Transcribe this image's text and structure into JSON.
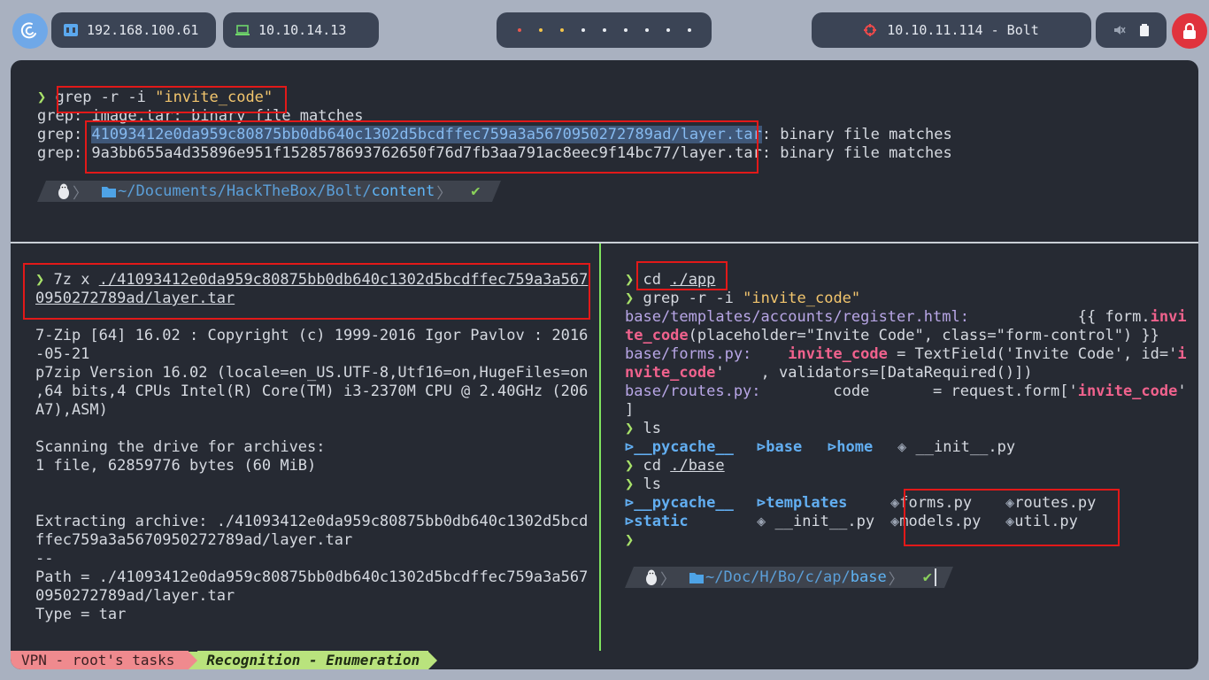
{
  "topbar": {
    "host_ip": "192.168.100.61",
    "vpn_ip": "10.10.14.13",
    "target": "10.10.11.114 - Bolt"
  },
  "top_pane": {
    "cmd1_prompt": "❯",
    "cmd1": "grep -r -i ",
    "cmd1_arg": "\"invite_code\"",
    "out1": "grep: image.tar: binary file matches",
    "out2_pre": "grep: ",
    "out2_path": "41093412e0da959c80875bb0db640c1302d5bcdffec759a3a5670950272789ad/layer.tar",
    "out2_post": ": binary file matches",
    "out3_pre": "grep: ",
    "out3_path": "9a3bb655a4d35896e951f1528578693762650f76d7fb3aa791ac8eec9f14bc77/layer.tar",
    "out3_post": ": binary file matches",
    "pl_dir": "~/Documents/HackTheBox/Bolt/",
    "pl_dir_last": "content",
    "pl_ok": "✔"
  },
  "left_pane": {
    "cmd_prompt": "❯",
    "cmd": "7z x ",
    "cmd_arg1": "./41093412e0da959c80875bb0db640c1302d5bcdffec759a3a567",
    "cmd_arg2": "0950272789ad/layer.tar",
    "lines": [
      "7-Zip [64] 16.02 : Copyright (c) 1999-2016 Igor Pavlov : 2016",
      "-05-21",
      "p7zip Version 16.02 (locale=en_US.UTF-8,Utf16=on,HugeFiles=on",
      ",64 bits,4 CPUs Intel(R) Core(TM) i3-2370M CPU @ 2.40GHz (206",
      "A7),ASM)",
      "",
      "Scanning the drive for archives:",
      "1 file, 62859776 bytes (60 MiB)",
      "",
      "",
      "Extracting archive: ./41093412e0da959c80875bb0db640c1302d5bcd",
      "ffec759a3a5670950272789ad/layer.tar",
      "--",
      "Path = ./41093412e0da959c80875bb0db640c1302d5bcdffec759a3a567",
      "0950272789ad/layer.tar",
      "Type = tar"
    ]
  },
  "right_pane": {
    "prompt": "❯",
    "cd_app": "cd ",
    "cd_app_arg": "./app",
    "grep_cmd": "grep -r -i ",
    "grep_arg": "\"invite_code\"",
    "r1_file": "base/templates/accounts/register.html:",
    "r1_rest": "            {{ form.",
    "r1_match_a": "invi",
    "r2_match_b": "te_code",
    "r2_rest": "(placeholder=\"Invite Code\", class=\"form-control\") }}",
    "r3_file": "base/forms.py:",
    "r3_gap": "    ",
    "r3_match": "invite_code",
    "r3_rest": " = TextField('Invite Code', id='",
    "r3_match2a": "i",
    "r4_match2b": "nvite_code",
    "r4_rest": "'    , validators=[DataRequired()])",
    "r5_file": "base/routes.py:",
    "r5_rest": "        code       = request.form['",
    "r5_match": "invite_code",
    "r5_end": "'",
    "r6": "]",
    "ls1": "ls",
    "ls1_items": [
      "__pycache__",
      "base",
      "home",
      "__init__.py"
    ],
    "cd_base": "cd ",
    "cd_base_arg": "./base",
    "ls2": "ls",
    "ls2_row1": [
      "__pycache__",
      "templates",
      "forms.py",
      "routes.py"
    ],
    "ls2_row2": [
      "static",
      "__init__.py",
      "models.py",
      "util.py"
    ],
    "pl_dir": "~/Doc/H/Bo/c/ap/",
    "pl_dir_last": "base",
    "pl_ok": "✔"
  },
  "statusbar": {
    "left": "VPN - root's tasks",
    "mid": "Recognition - Enumeration"
  }
}
